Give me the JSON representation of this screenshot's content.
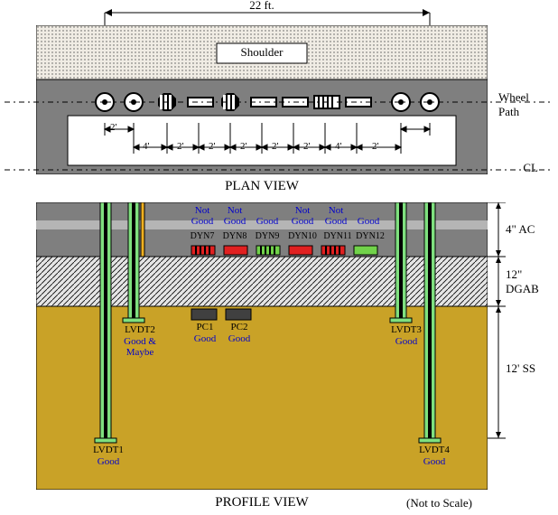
{
  "overall": {
    "span_label": "22 ft."
  },
  "plan": {
    "caption": "PLAN VIEW",
    "shoulder_label": "Shoulder",
    "wheel_path_label": "Wheel\nPath",
    "cl_label": "CL",
    "dim_labels": [
      "2'",
      "4'",
      "2'",
      "2'",
      "2'",
      "2'",
      "2'",
      "4'",
      "2'"
    ]
  },
  "profile": {
    "caption": "PROFILE VIEW",
    "scale_note": "(Not to Scale)",
    "layers": {
      "ac": "4\" AC",
      "dgab": "12\" DGAB",
      "ss": "12' SS"
    },
    "dyn": [
      {
        "name": "DYN7",
        "status": "Not Good"
      },
      {
        "name": "DYN8",
        "status": "Not Good"
      },
      {
        "name": "DYN9",
        "status": "Good"
      },
      {
        "name": "DYN10",
        "status": "Not Good"
      },
      {
        "name": "DYN11",
        "status": "Not Good"
      },
      {
        "name": "DYN12",
        "status": "Good"
      }
    ],
    "pc": [
      {
        "name": "PC1",
        "status": "Good"
      },
      {
        "name": "PC2",
        "status": "Good"
      }
    ],
    "lvdt": [
      {
        "name": "LVDT1",
        "status": "Good"
      },
      {
        "name": "LVDT2",
        "status": "Good & Maybe"
      },
      {
        "name": "LVDT3",
        "status": "Good"
      },
      {
        "name": "LVDT4",
        "status": "Good"
      }
    ]
  },
  "colors": {
    "road": "#7f7f7f",
    "shoulder_fill": "#f0ece4",
    "ac": "#7f7f7f",
    "acband": "#a5a5a5",
    "dgab": "#e5e5e5",
    "soil": "#c9a227",
    "lvdt_tube": "#7fe07f",
    "lvdt_core": "#000",
    "pc": "#404040",
    "good": "#71d24a",
    "bad": "#e02020",
    "blue": "#0000cc"
  }
}
